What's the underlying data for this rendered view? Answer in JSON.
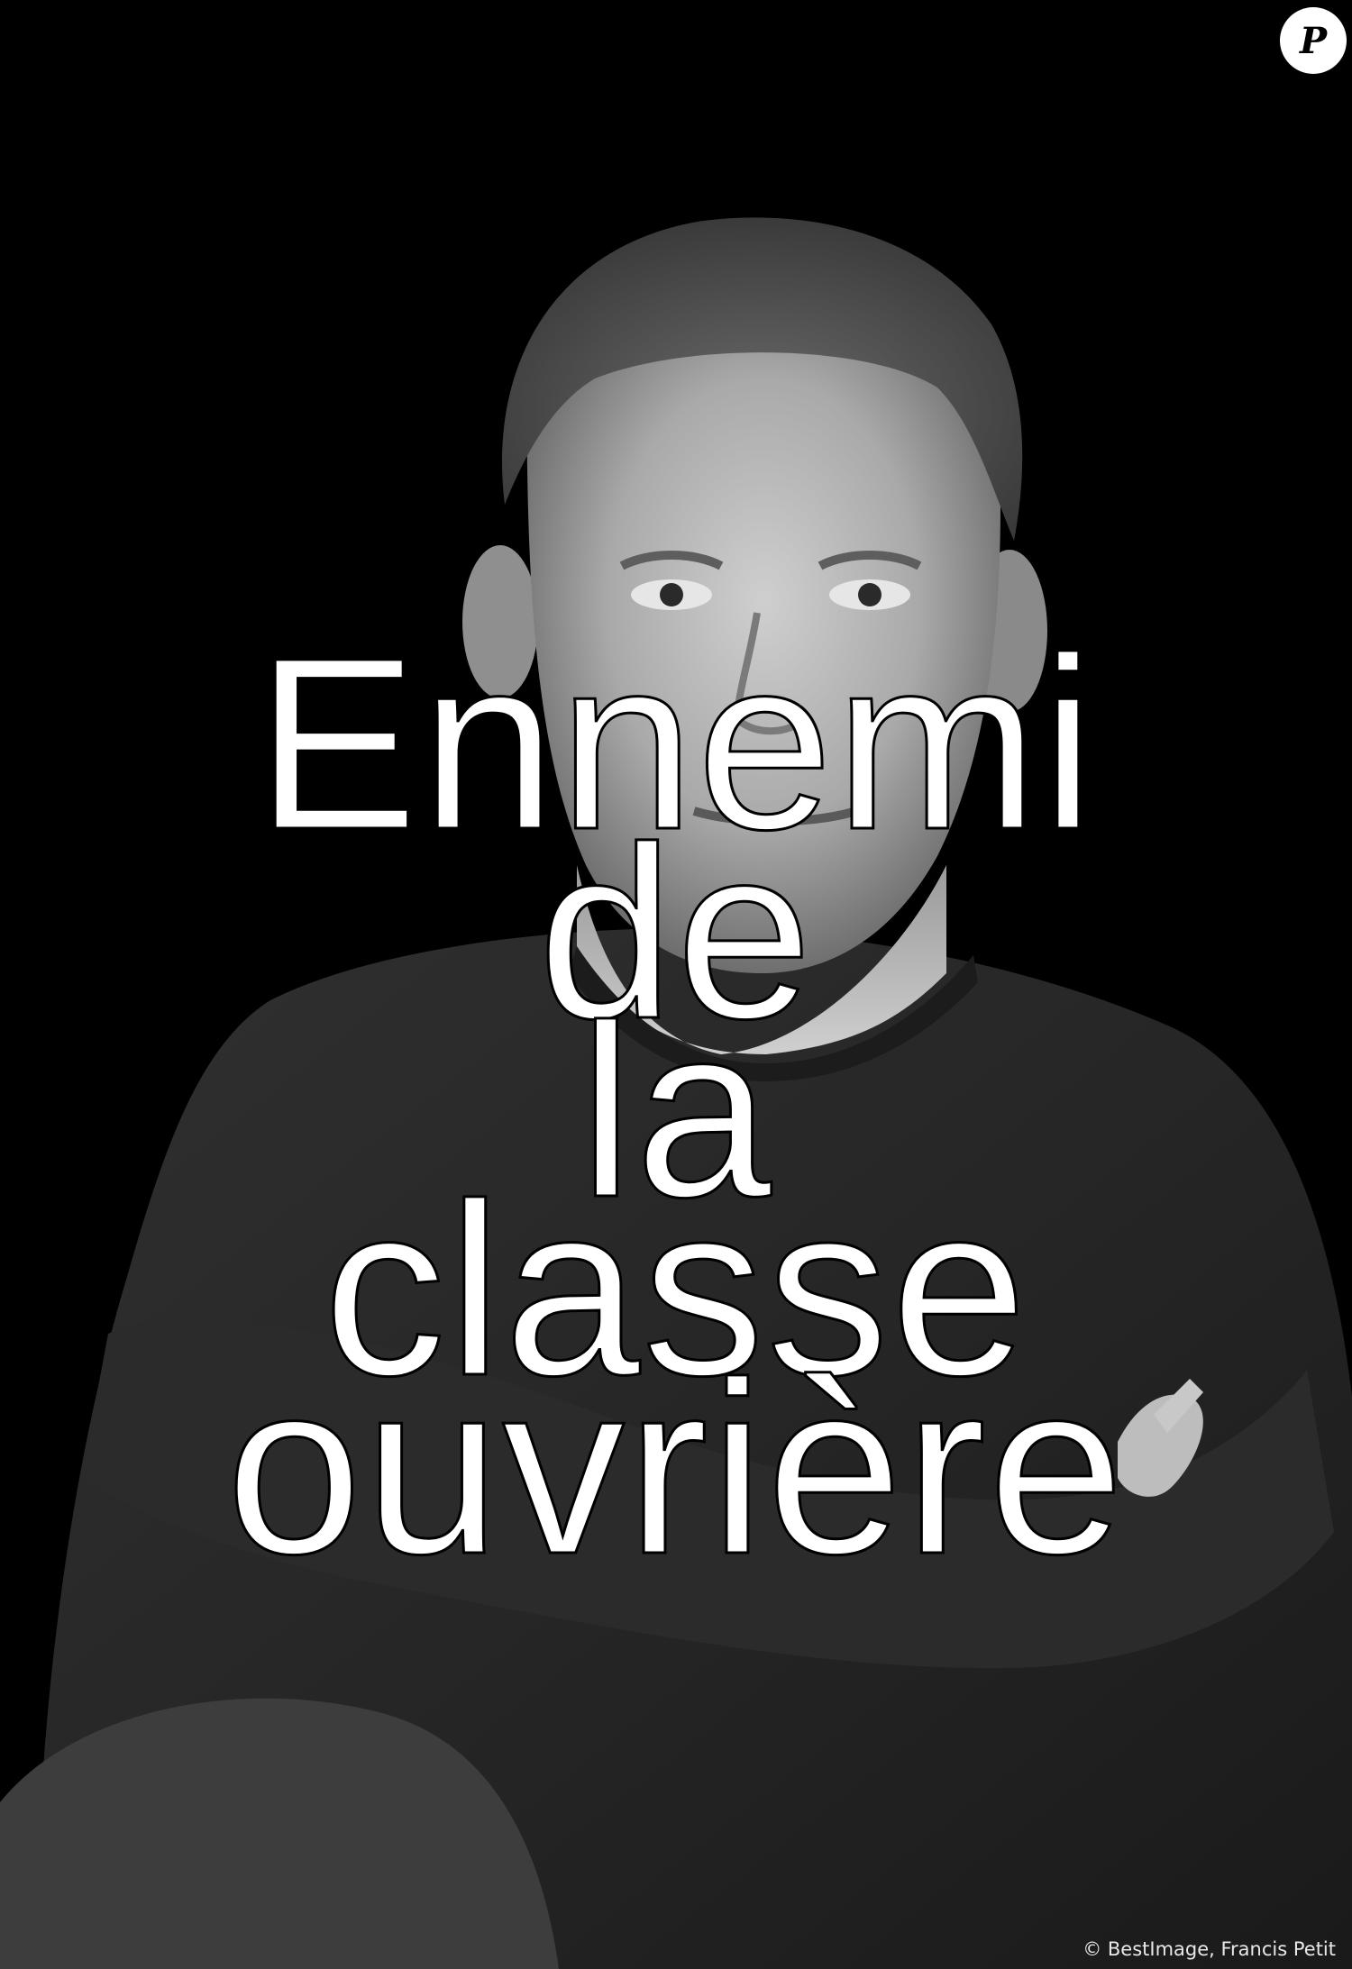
{
  "image": {
    "subject": "black-and-white portrait photograph",
    "background_color": "#000000",
    "text_color": "#ffffff",
    "text_outline_color": "#000000"
  },
  "logo": {
    "letter": "P",
    "icon": "publication-logo-icon"
  },
  "overlay": {
    "lines": [
      "Ennemi",
      "de",
      "la",
      "classe",
      "ouvrière"
    ]
  },
  "credit": {
    "text": "© BestImage, Francis Petit"
  }
}
